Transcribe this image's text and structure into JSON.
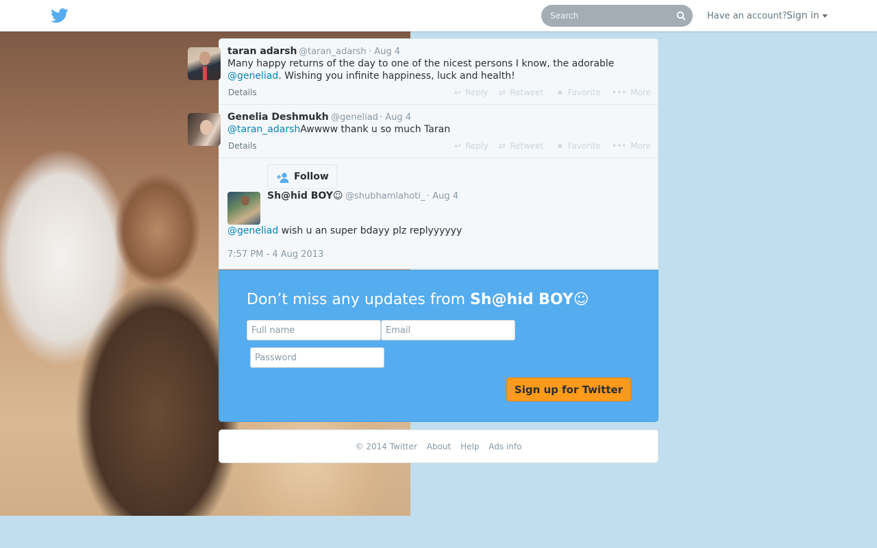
{
  "brand": {
    "logo_icon": "twitter-bird-icon",
    "color": "#55acee"
  },
  "topbar": {
    "search_placeholder": "Search",
    "have_account": "Have an account?",
    "sign_in": "Sign in"
  },
  "tweets": [
    {
      "name": "taran adarsh",
      "handle": "@taran_adarsh",
      "date": "· Aug 4",
      "text_line1": "Many happy returns of the day to one of the nicest persons I know, the adorable",
      "mention": "@geneliad",
      "text_line2_rest": ". Wishing you infinite happiness, luck and health!",
      "details": "Details",
      "actions": {
        "reply": "Reply",
        "retweet": "Retweet",
        "favorite": "Favorite",
        "more": "More"
      }
    },
    {
      "name": "Genelia Deshmukh",
      "handle": "@geneliad",
      "date": "· Aug 4",
      "mention": "@taran_adarsh",
      "text": "Awwww thank u so much Taran",
      "details": "Details",
      "actions": {
        "reply": "Reply",
        "retweet": "Retweet",
        "favorite": "Favorite",
        "more": "More"
      }
    }
  ],
  "focused_tweet": {
    "follow_label": "Follow",
    "name": "Sh@hid BOY☺",
    "handle": "@shubhamlahoti_",
    "date": "· Aug 4",
    "mention": "@geneliad",
    "text": " wish u an super bdayy plz replyyyyyy",
    "timestamp": "7:57 PM - 4 Aug 2013"
  },
  "signup": {
    "title_prefix": "Don’t miss any updates from ",
    "title_name": "Sh@hid BOY☺",
    "full_name_placeholder": "Full name",
    "email_placeholder": "Email",
    "password_placeholder": "Password",
    "button_label": "Sign up for Twitter",
    "button_color": "#ff9a1a"
  },
  "footer": {
    "copyright": "© 2014 Twitter",
    "about": "About",
    "help": "Help",
    "ads_info": "Ads info"
  }
}
